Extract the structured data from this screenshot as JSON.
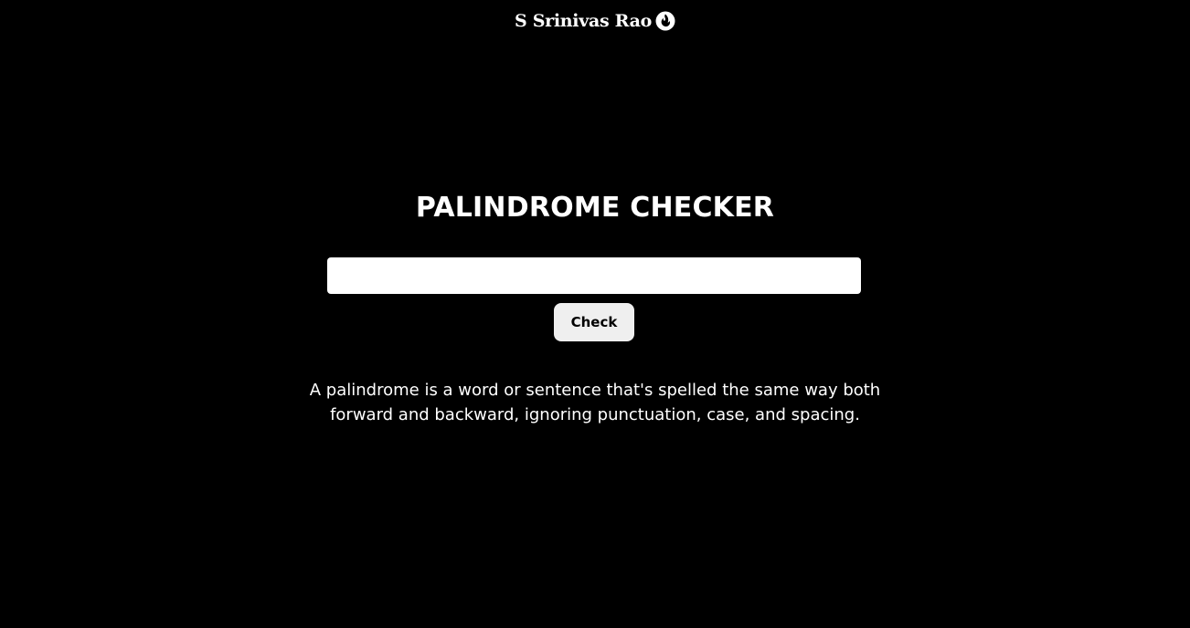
{
  "header": {
    "brand_name": "S Srinivas Rao",
    "brand_icon": "flame-logo-icon"
  },
  "main": {
    "title": "PALINDROME CHECKER",
    "input": {
      "value": "",
      "placeholder": ""
    },
    "check_button_label": "Check",
    "description": "A palindrome is a word or sentence that's spelled the same way both forward and backward, ignoring punctuation, case, and spacing."
  },
  "colors": {
    "background": "#000000",
    "text": "#ffffff",
    "input_background": "#ffffff",
    "button_background": "#efefef"
  }
}
